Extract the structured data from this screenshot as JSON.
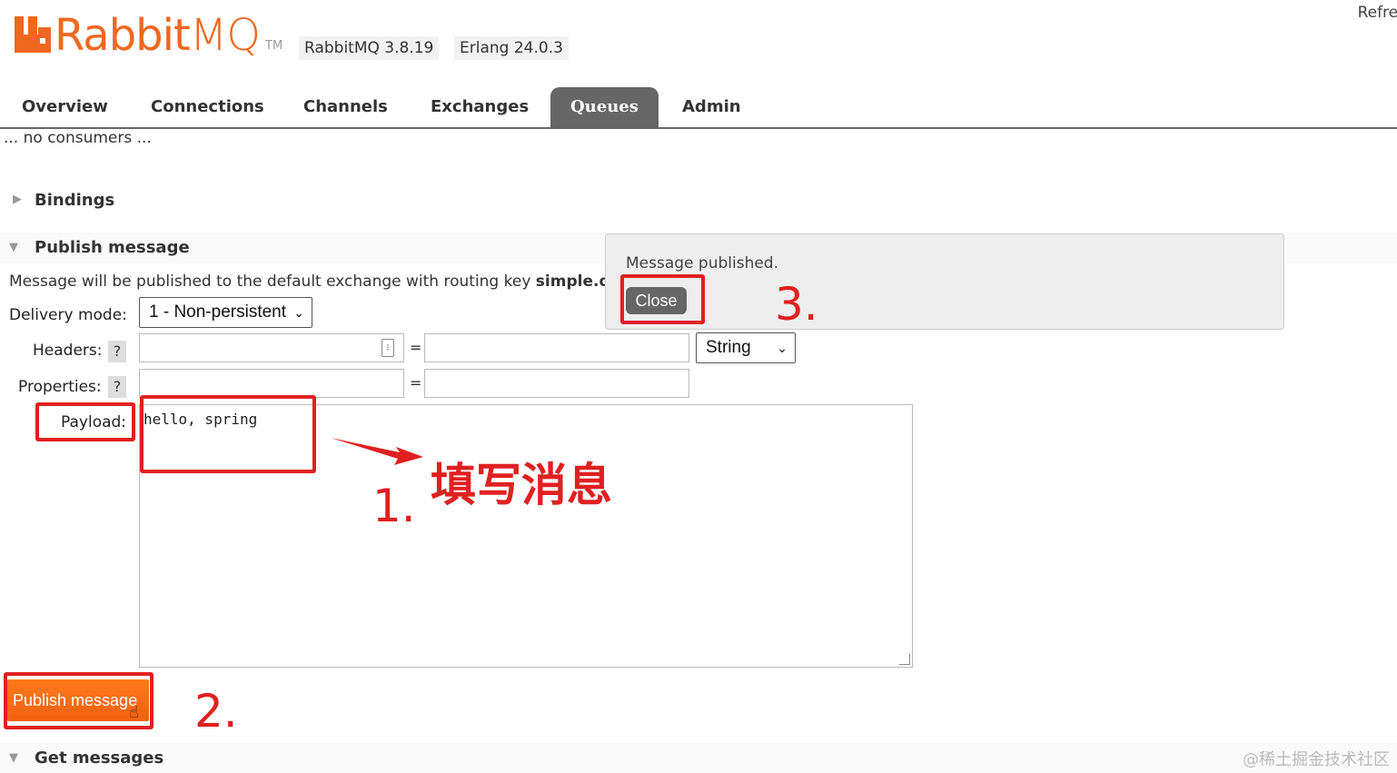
{
  "header": {
    "logo_rabbit": "Rabbit",
    "logo_mq": "MQ",
    "logo_tm": "TM",
    "version": "RabbitMQ 3.8.19",
    "erlang": "Erlang 24.0.3",
    "refresh": "Refres"
  },
  "nav": {
    "tabs": [
      "Overview",
      "Connections",
      "Channels",
      "Exchanges",
      "Queues",
      "Admin"
    ],
    "active": "Queues"
  },
  "consumers_text": "... no consumers ...",
  "bindings_title": "Bindings",
  "publish": {
    "title": "Publish message",
    "description": "Message will be published to the default exchange with routing key",
    "routing_key": "simple.q",
    "delivery_mode_label": "Delivery mode:",
    "delivery_mode_value": "1 - Non-persistent",
    "headers_label": "Headers:",
    "properties_label": "Properties:",
    "help": "?",
    "equals": "=",
    "header_type": "String",
    "payload_label": "Payload:",
    "payload_value": "hello, spring",
    "button": "Publish message"
  },
  "get_messages_title": "Get messages",
  "popup": {
    "message": "Message published.",
    "close": "Close"
  },
  "annotations": {
    "step1": "1.",
    "step1_text": "填写消息",
    "step2": "2.",
    "step3": "3."
  },
  "watermark": "@稀土掘金技术社区",
  "colors": {
    "brand": "#f06820",
    "annotation": "#e02020",
    "active_tab": "#666666"
  }
}
